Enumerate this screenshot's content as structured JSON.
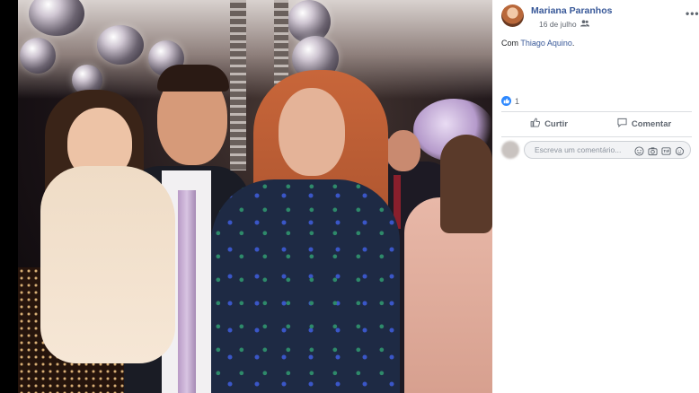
{
  "post": {
    "author": "Mariana Paranhos",
    "date": "16 de julho",
    "privacy_icon": "friends-icon",
    "with_prefix": "Com",
    "tagged_person": "Thiago Aquino",
    "tagged_suffix": "."
  },
  "reactions": {
    "icon": "like-icon",
    "count": "1"
  },
  "actions": {
    "like_label": "Curtir",
    "comment_label": "Comentar"
  },
  "comment_box": {
    "placeholder": "Escreva um comentário...",
    "icons": [
      "emoji-icon",
      "camera-icon",
      "gif-icon",
      "sticker-icon"
    ]
  },
  "colors": {
    "link": "#385898",
    "like_blue": "#2d88ff",
    "muted_text": "#616770"
  }
}
